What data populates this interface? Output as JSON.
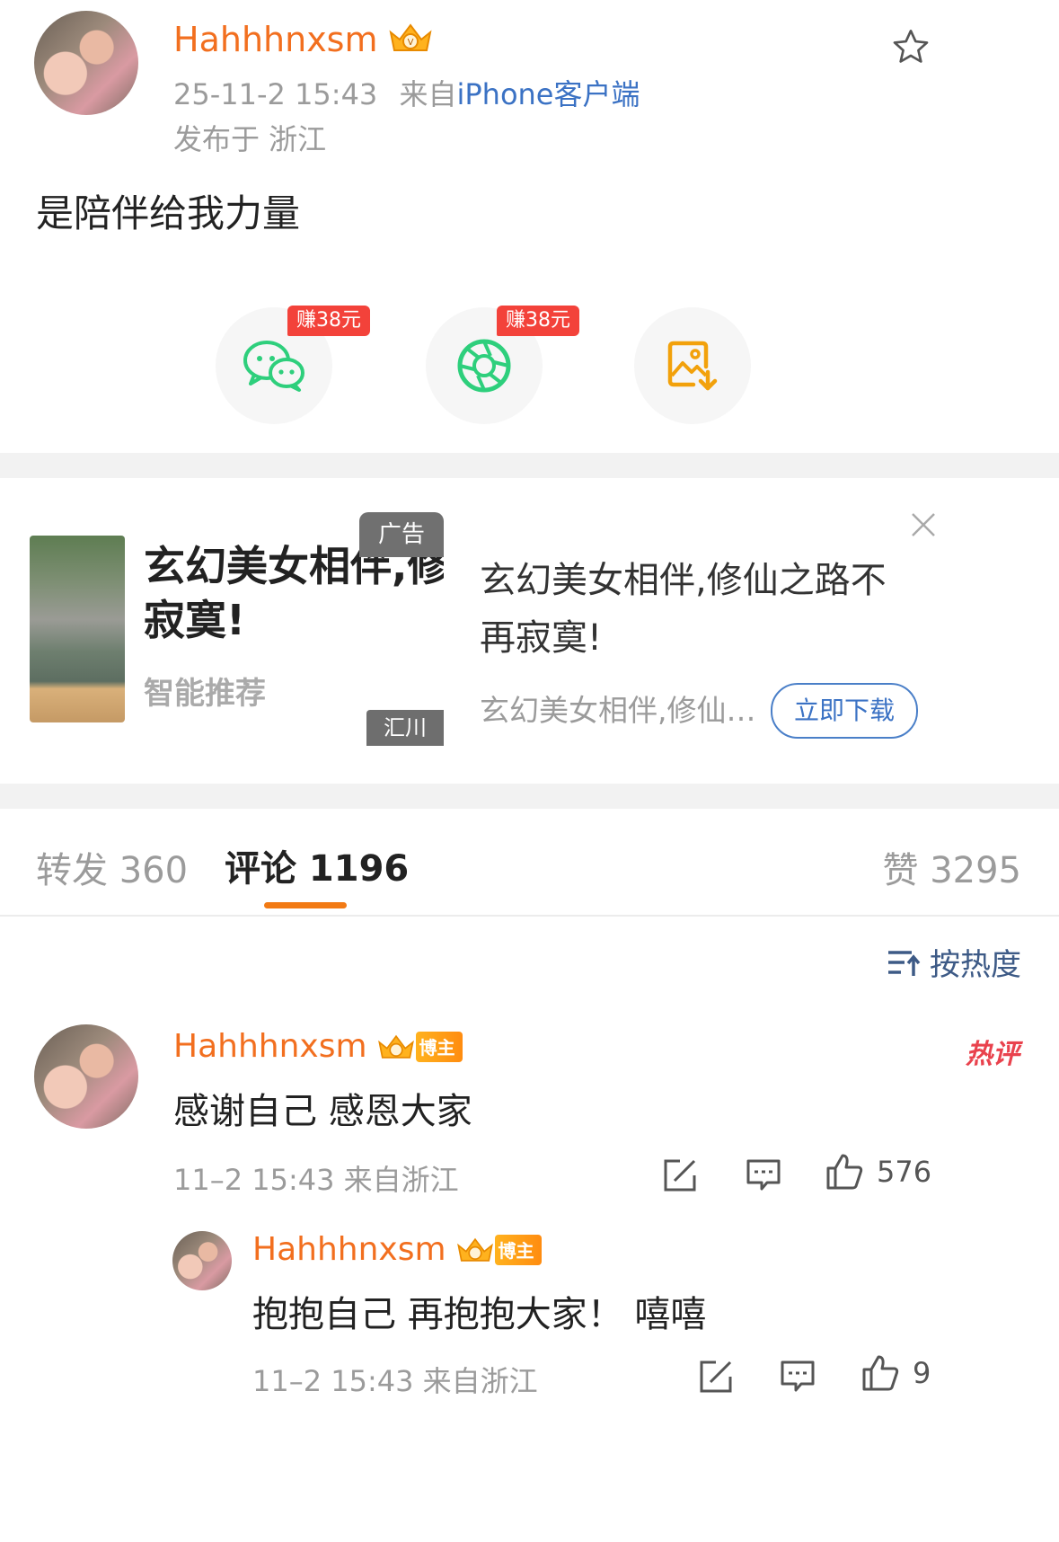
{
  "post": {
    "username": "Hahhhnxsm",
    "timestamp": "25-11-2 15:43",
    "source_prefix": "来自",
    "source": "iPhone客户端",
    "location": "发布于 浙江",
    "content": "是陪伴给我力量"
  },
  "share": {
    "wechat_badge": "赚38元",
    "moments_badge": "赚38元"
  },
  "ad": {
    "tag": "广告",
    "card_title_line1": "玄幻美女相伴,修",
    "card_title_line2": "寂寞!",
    "card_sub": "智能推荐",
    "card_corner": "汇川",
    "title_line1": "玄幻美女相伴,修仙之路不",
    "title_line2": "再寂寞!",
    "desc": "玄幻美女相伴,修仙…",
    "download": "立即下载"
  },
  "tabs": {
    "repost": "转发 360",
    "comment": "评论 1196",
    "like": "赞 3295"
  },
  "sort": {
    "label": "按热度"
  },
  "comments": [
    {
      "username": "Hahhhnxsm",
      "badge": "博主",
      "hot": "热评",
      "text": "感谢自己 感恩大家",
      "meta": "11–2 15:43 来自浙江",
      "likes": "576"
    },
    {
      "username": "Hahhhnxsm",
      "badge": "博主",
      "text": "抱抱自己 再抱抱大家！ 嘻嘻",
      "meta": "11–2 15:43 来自浙江",
      "likes": "9"
    }
  ],
  "colors": {
    "accent_orange": "#f26f1f",
    "link_blue": "#3b72c4",
    "badge_red": "#f3423a",
    "wechat_green": "#2ecf7c"
  },
  "icons": [
    "crown-vip-icon",
    "star-icon",
    "wechat-icon",
    "moments-icon",
    "save-image-icon",
    "close-icon",
    "sort-icon",
    "repost-icon",
    "comment-icon",
    "like-icon"
  ]
}
